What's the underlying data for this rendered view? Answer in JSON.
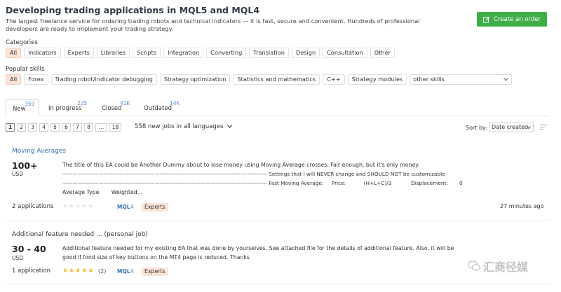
{
  "header": {
    "title": "Developing trading applications in MQL5 and MQL4",
    "subtitle": "The largest freelance service for ordering trading robots and technical indicators — it is fast, secure and convenient. Hundreds of professional developers are ready to implement your trading strategy.",
    "create_order_label": "Create an order"
  },
  "categories": {
    "label": "Categories",
    "items": [
      "All",
      "Indicators",
      "Experts",
      "Libraries",
      "Scripts",
      "Integration",
      "Converting",
      "Translation",
      "Design",
      "Consultation",
      "Other"
    ]
  },
  "skills": {
    "label": "Popular skills",
    "items": [
      "All",
      "Forex",
      "Trading robot/indicator debugging",
      "Strategy optimization",
      "Statistics and mathematics",
      "C++",
      "Strategy modules"
    ],
    "other_select": "other skills"
  },
  "tabs": [
    {
      "label": "New",
      "count": "359"
    },
    {
      "label": "In progress",
      "count": "225"
    },
    {
      "label": "Closed",
      "count": "41K"
    },
    {
      "label": "Outdated",
      "count": "14K"
    }
  ],
  "pagination": {
    "pages": [
      "1",
      "2",
      "3",
      "4",
      "5",
      "6",
      "7",
      "8",
      "...",
      "18"
    ],
    "jobs_text": "558 new jobs in all languages"
  },
  "sort": {
    "label": "Sort by:",
    "value": "Date created"
  },
  "jobs": [
    {
      "title": "Moving Averages",
      "price": "100+",
      "currency": "USD",
      "desc_line1": "The title of this EA could be Another Dummy about to lose money using Moving Average crosses. Fair enough, but it's only money.",
      "desc_line2": "———————————————————————————————————————— Settings that I will NEVER change and SHOULD NOT be customizable",
      "desc_line3": "———————————————————————————————————————— Fast Moving Average:     Price:           (H+L+C)/3            Displacement:       0",
      "desc_line4": "Average Type       Weighted...",
      "applications": "2 applications",
      "rating": 0,
      "reviews": "",
      "platform": "MQL4",
      "category": "Experts",
      "time": "27 minutes ago"
    },
    {
      "title": "Additional feature needed ... (personal job)",
      "price": "30 - 40",
      "currency": "USD",
      "desc_line1": "Additional feature needed for my existing EA that was done by yourselves. See attached file for the details of additional feature. Also, it will be",
      "desc_line2": "good if fond size of key buttons on the MT4 page is reduced. Thanks",
      "applications": "1 application",
      "rating": 5,
      "reviews": "(2)",
      "platform": "MQL4",
      "category": "Experts"
    }
  ],
  "watermark": "汇商径媒",
  "colors": {
    "accent_green": "#3fae49",
    "chip_active": "#fbe4d7",
    "link_blue": "#2f6fb9",
    "star_gold": "#f0b820"
  }
}
